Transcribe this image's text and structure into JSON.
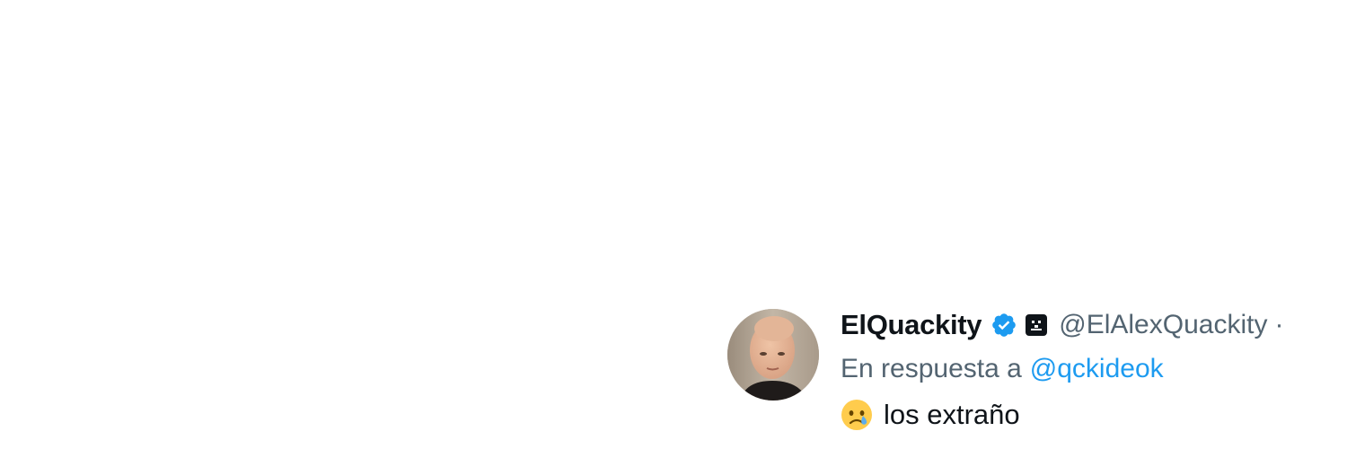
{
  "tweet": {
    "author": {
      "display_name": "ElQuackity",
      "handle": "@ElAlexQuackity",
      "separator": "·",
      "verified_icon": "verified-badge-icon",
      "affiliate_icon": "affiliate-badge-icon",
      "avatar_icon": "profile-photo"
    },
    "reply": {
      "prefix": "En respuesta a",
      "mention": "@qckideok"
    },
    "text": {
      "emoji": "crying-face-emoji",
      "body": "los extraño"
    },
    "colors": {
      "name": "#0f1419",
      "secondary": "#536471",
      "link": "#1d9bf0",
      "verified": "#1d9bf0"
    }
  }
}
